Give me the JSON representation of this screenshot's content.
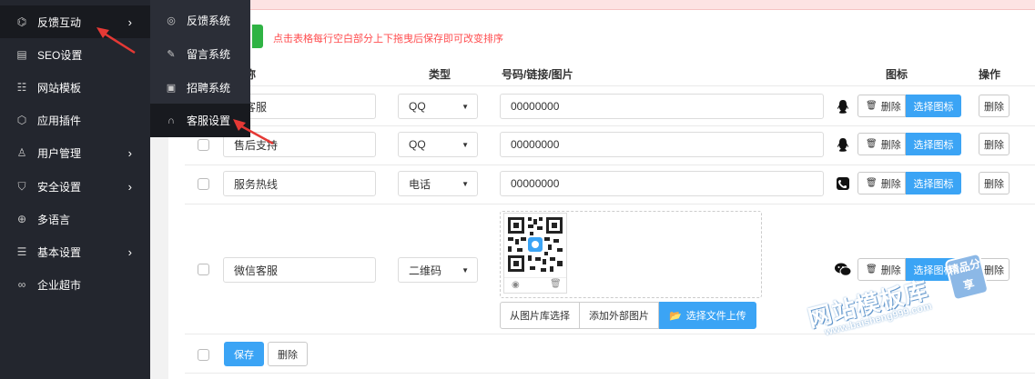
{
  "sidebar": {
    "items": [
      {
        "label": "反馈互动",
        "icon": "feedback-icon",
        "has_arrow": true
      },
      {
        "label": "SEO设置",
        "icon": "seo-icon",
        "has_arrow": false
      },
      {
        "label": "网站模板",
        "icon": "template-icon",
        "has_arrow": false
      },
      {
        "label": "应用插件",
        "icon": "plugin-icon",
        "has_arrow": false
      },
      {
        "label": "用户管理",
        "icon": "user-icon",
        "has_arrow": true
      },
      {
        "label": "安全设置",
        "icon": "shield-icon",
        "has_arrow": true
      },
      {
        "label": "多语言",
        "icon": "globe-icon",
        "has_arrow": false
      },
      {
        "label": "基本设置",
        "icon": "settings-icon",
        "has_arrow": true
      },
      {
        "label": "企业超市",
        "icon": "market-icon",
        "has_arrow": false
      }
    ],
    "arrow": "›"
  },
  "submenu": {
    "items": [
      {
        "label": "反馈系统",
        "icon": "chat-icon"
      },
      {
        "label": "留言系统",
        "icon": "edit-icon"
      },
      {
        "label": "招聘系统",
        "icon": "recruit-icon"
      },
      {
        "label": "客服设置",
        "icon": "headset-icon"
      }
    ]
  },
  "hint": "点击表格每行空白部分上下拖曳后保存即可改变排序",
  "table": {
    "headers": {
      "name": "名称",
      "type": "类型",
      "value": "号码/链接/图片",
      "icon": "图标",
      "action": "操作"
    },
    "rows": [
      {
        "name": "前客服",
        "type": "QQ",
        "value": "00000000",
        "icon": "qq-icon"
      },
      {
        "name": "售后支持",
        "type": "QQ",
        "value": "00000000",
        "icon": "qq-icon"
      },
      {
        "name": "服务热线",
        "type": "电话",
        "value": "00000000",
        "icon": "phone-icon"
      },
      {
        "name": "微信客服",
        "type": "二维码",
        "value": "",
        "icon": "wechat-icon"
      }
    ],
    "icon_delete_label": "删除",
    "icon_choose_label": "选择图标",
    "row_delete_label": "删除"
  },
  "upload": {
    "from_library": "从图片库选择",
    "add_external": "添加外部图片",
    "choose_file": "选择文件上传"
  },
  "footer": {
    "save": "保存",
    "delete": "删除"
  },
  "watermark": {
    "title": "网站模板库",
    "url": "www.baisheng999.com",
    "stamp": "精品分享"
  },
  "colors": {
    "sidebar_bg": "#23262e",
    "primary": "#3ba4f5",
    "danger_text": "#ff4d4f",
    "success": "#2fb344"
  }
}
